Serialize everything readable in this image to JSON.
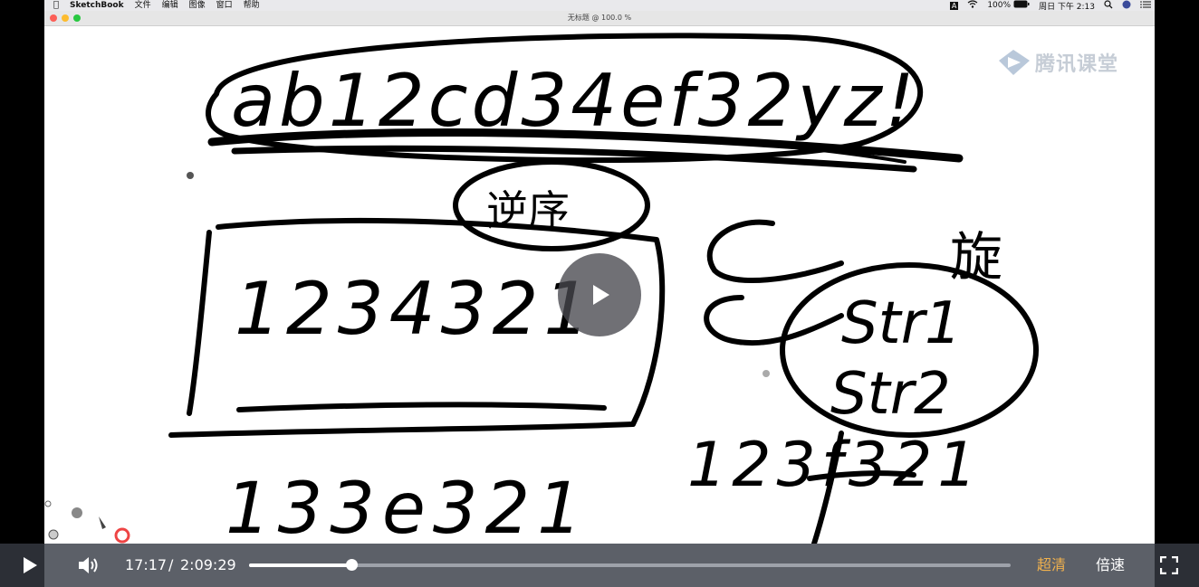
{
  "menubar": {
    "app_name": "SketchBook",
    "items": [
      "文件",
      "编辑",
      "图像",
      "窗口",
      "帮助"
    ],
    "battery": "100%",
    "clock": "周日 下午 2:13"
  },
  "window": {
    "title": "无标题 @ 100.0 %"
  },
  "watermark": {
    "text": "腾讯课堂"
  },
  "sketch": {
    "line1": "ab12cd34ef32yz!",
    "circle_label": "逆序",
    "box_text": "1234321",
    "bottom_left": "133e321",
    "right_label": "旋",
    "circle_right_1": "Str1",
    "circle_right_2": "Str2",
    "bottom_right": "123f321"
  },
  "player": {
    "current_time": "17:17",
    "separator": "/",
    "duration": "2:09:29",
    "progress": 0.134,
    "quality_label": "超清",
    "speed_label": "倍速",
    "colors": {
      "accent": "#f0b14e",
      "bar_bg": "#5c6068"
    }
  }
}
